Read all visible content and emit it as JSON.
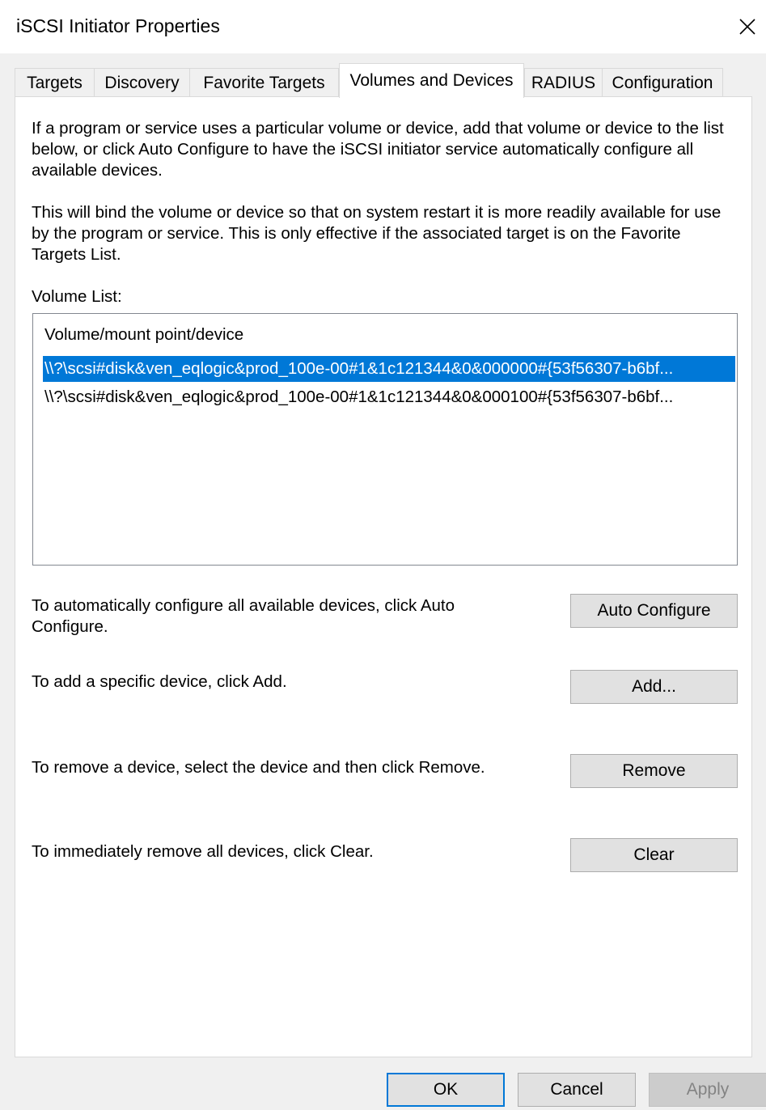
{
  "window": {
    "title": "iSCSI Initiator Properties",
    "close_icon": "close-icon"
  },
  "tabs": [
    {
      "label": "Targets",
      "active": false
    },
    {
      "label": "Discovery",
      "active": false
    },
    {
      "label": "Favorite Targets",
      "active": false
    },
    {
      "label": "Volumes and Devices",
      "active": true
    },
    {
      "label": "RADIUS",
      "active": false
    },
    {
      "label": "Configuration",
      "active": false
    }
  ],
  "content": {
    "intro_text": "If a program or service uses a particular volume or device, add that volume or device to the list below, or click Auto Configure to have the iSCSI initiator service automatically configure all available devices.",
    "bind_text": "This will bind the volume or device so that on system restart it is more readily available for use by the program or service.  This is only effective if the associated target is on the Favorite Targets List.",
    "volume_list_label": "Volume List:",
    "volume_list": {
      "column_header": "Volume/mount point/device",
      "items": [
        {
          "value": "\\\\?\\scsi#disk&ven_eqlogic&prod_100e-00#1&1c121344&0&000000#{53f56307-b6bf...",
          "selected": true
        },
        {
          "value": "\\\\?\\scsi#disk&ven_eqlogic&prod_100e-00#1&1c121344&0&000100#{53f56307-b6bf...",
          "selected": false
        }
      ]
    },
    "auto_configure": {
      "description": "To automatically configure all available devices, click Auto Configure.",
      "button_label": "Auto Configure"
    },
    "add": {
      "description": "To add a specific device, click Add.",
      "button_label": "Add..."
    },
    "remove": {
      "description": "To remove a device, select the device and then click Remove.",
      "button_label": "Remove"
    },
    "clear": {
      "description": "To immediately remove all devices, click Clear.",
      "button_label": "Clear"
    }
  },
  "footer": {
    "ok_label": "OK",
    "cancel_label": "Cancel",
    "apply_label": "Apply",
    "apply_enabled": false
  },
  "colors": {
    "selection": "#0078d7",
    "dialog_bg": "#f0f0f0",
    "button_bg": "#e1e1e1"
  }
}
